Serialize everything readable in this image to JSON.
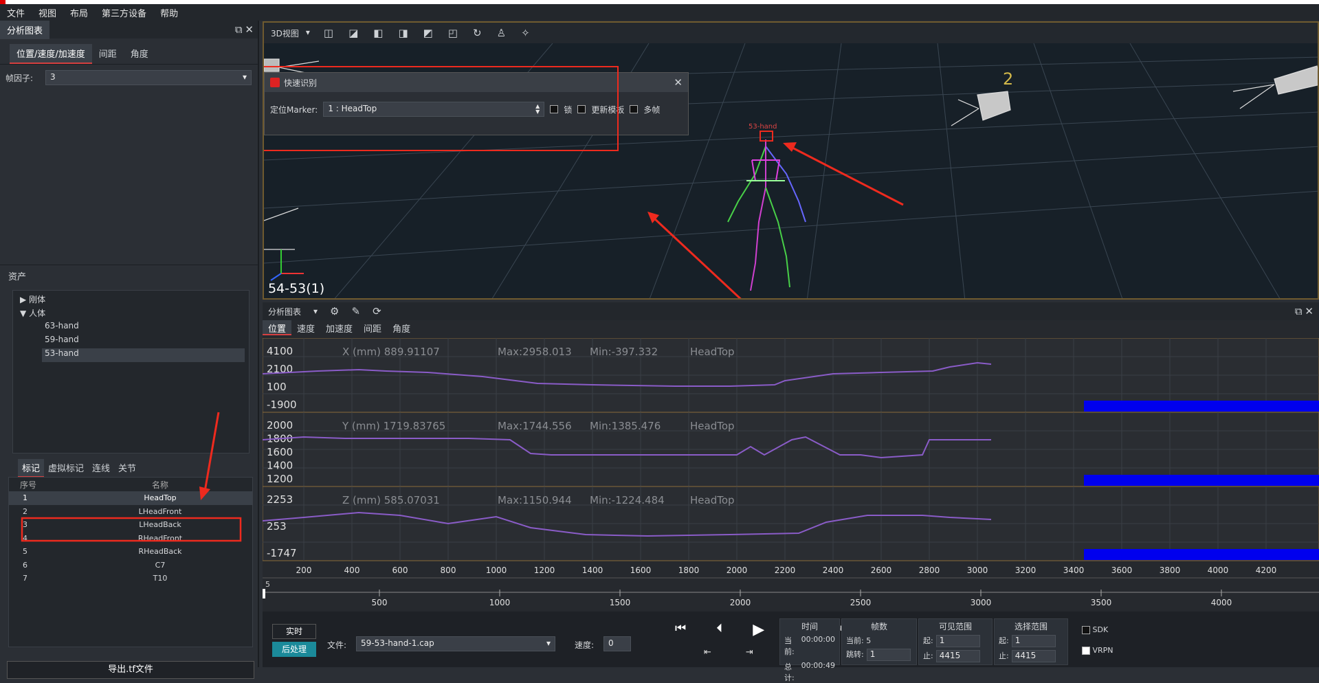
{
  "menu": [
    "文件",
    "视图",
    "布局",
    "第三方设备",
    "帮助"
  ],
  "left": {
    "panel_title": "分析图表",
    "tabs": [
      "位置/速度/加速度",
      "间距",
      "角度"
    ],
    "frame_label": "帧因子:",
    "frame_value": "3",
    "assets_title": "资产",
    "tree": [
      {
        "label": "刚体",
        "expanded": false
      },
      {
        "label": "人体",
        "expanded": true,
        "children": [
          "63-hand",
          "59-hand",
          "53-hand"
        ]
      }
    ],
    "marker_tabs": [
      "标记",
      "虚拟标记",
      "连线",
      "关节"
    ],
    "table_headers": [
      "序号",
      "名称"
    ],
    "markers": [
      [
        "1",
        "HeadTop"
      ],
      [
        "2",
        "LHeadFront"
      ],
      [
        "3",
        "LHeadBack"
      ],
      [
        "4",
        "RHeadFront"
      ],
      [
        "5",
        "RHeadBack"
      ],
      [
        "6",
        "C7"
      ],
      [
        "7",
        "T10"
      ]
    ],
    "export_label": "导出.tf文件"
  },
  "view3d": {
    "label": "3D视图",
    "camera_number": "2",
    "take_label": "54-53(1)",
    "subject_label": "53-hand"
  },
  "quick": {
    "title": "快速识别",
    "marker_label": "定位Marker:",
    "marker_value": "1 : HeadTop",
    "lock": "锁",
    "update": "更新模板",
    "multi": "多帧"
  },
  "chart": {
    "title": "分析图表",
    "tabs": [
      "位置",
      "速度",
      "加速度",
      "间距",
      "角度"
    ],
    "plots": [
      {
        "label": "X (mm) 889.91107",
        "max": "Max:2958.013",
        "min": "Min:-397.332",
        "marker": "HeadTop",
        "yticks": [
          "4100",
          "2100",
          "100",
          "-1900"
        ]
      },
      {
        "label": "Y (mm) 1719.83765",
        "max": "Max:1744.556",
        "min": "Min:1385.476",
        "marker": "HeadTop",
        "yticks": [
          "2000",
          "1800",
          "1600",
          "1400",
          "1200"
        ]
      },
      {
        "label": "Z (mm) 585.07031",
        "max": "Max:1150.944",
        "min": "Min:-1224.484",
        "marker": "HeadTop",
        "yticks": [
          "2253",
          "253",
          "-1747"
        ]
      }
    ],
    "xticks": [
      "200",
      "400",
      "600",
      "800",
      "1000",
      "1200",
      "1400",
      "1600",
      "1800",
      "2000",
      "2200",
      "2400",
      "2600",
      "2800",
      "3000",
      "3200",
      "3400",
      "3600",
      "3800",
      "4000",
      "4200"
    ],
    "timeline_start": "5",
    "timeline_ticks": [
      "500",
      "1000",
      "1500",
      "2000",
      "2500",
      "3000",
      "3500",
      "4000"
    ]
  },
  "transport": {
    "realtime": "实时",
    "post": "后处理",
    "file_label": "文件:",
    "file_value": "59-53-hand-1.cap",
    "speed_label": "速度:",
    "speed_value": "0",
    "time_title": "时间",
    "frames_title": "帧数",
    "visible_title": "可见范围",
    "select_title": "选择范围",
    "cur_label": "当前:",
    "cur_time": "00:00:00",
    "total_label": "总计:",
    "total_time": "00:00:49",
    "frame_cur_label": "当前:",
    "frame_cur": "5",
    "jump_label": "跳转:",
    "jump_value": "1",
    "vis_start_label": "起:",
    "vis_start": "1",
    "vis_end_label": "止:",
    "vis_end": "4415",
    "sel_start_label": "起:",
    "sel_start": "1",
    "sel_end_label": "止:",
    "sel_end": "4415",
    "sdk": "SDK",
    "vrpn": "VRPN"
  }
}
